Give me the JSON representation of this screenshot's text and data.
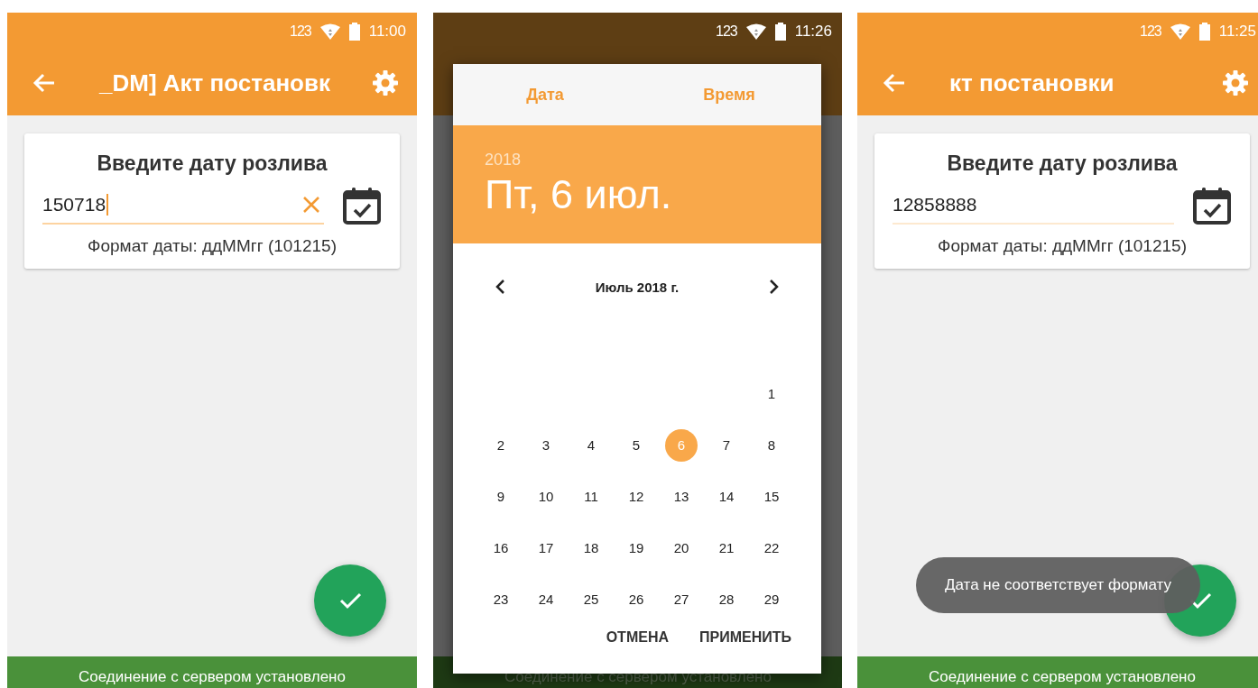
{
  "screens": [
    {
      "kind": "form",
      "status": {
        "indicator": "123",
        "time": "11:00"
      },
      "toolbar": {
        "title": "_DM] Акт постановк"
      },
      "card": {
        "title": "Введите дату розлива",
        "field": {
          "value": "150718",
          "focused": true,
          "clearable": true
        },
        "hint": "Формат даты: ддММгг (101215)"
      },
      "footer": "Соединение с сервером установлено"
    },
    {
      "kind": "picker",
      "status": {
        "indicator": "123",
        "time": "11:26"
      },
      "dialog": {
        "tabs": [
          "Дата",
          "Время"
        ],
        "year": "2018",
        "date": "Пт, 6 июл.",
        "month": "Июль 2018 г.",
        "weeks": [
          [
            {
              "day": "1",
              "selected": false
            }
          ],
          [
            {
              "day": "2",
              "selected": false
            },
            {
              "day": "3",
              "selected": false
            },
            {
              "day": "4",
              "selected": false
            },
            {
              "day": "5",
              "selected": false
            },
            {
              "day": "6",
              "selected": true
            },
            {
              "day": "7",
              "selected": false
            },
            {
              "day": "8",
              "selected": false
            }
          ],
          [
            {
              "day": "9",
              "selected": false
            },
            {
              "day": "10",
              "selected": false
            },
            {
              "day": "11",
              "selected": false
            },
            {
              "day": "12",
              "selected": false
            },
            {
              "day": "13",
              "selected": false
            },
            {
              "day": "14",
              "selected": false
            },
            {
              "day": "15",
              "selected": false
            }
          ],
          [
            {
              "day": "16",
              "selected": false
            },
            {
              "day": "17",
              "selected": false
            },
            {
              "day": "18",
              "selected": false
            },
            {
              "day": "19",
              "selected": false
            },
            {
              "day": "20",
              "selected": false
            },
            {
              "day": "21",
              "selected": false
            },
            {
              "day": "22",
              "selected": false
            }
          ],
          [
            {
              "day": "23",
              "selected": false
            },
            {
              "day": "24",
              "selected": false
            },
            {
              "day": "25",
              "selected": false
            },
            {
              "day": "26",
              "selected": false
            },
            {
              "day": "27",
              "selected": false
            },
            {
              "day": "28",
              "selected": false
            },
            {
              "day": "29",
              "selected": false
            }
          ]
        ],
        "buttons": [
          "ОТМЕНА",
          "ПРИМЕНИТЬ"
        ]
      },
      "footer": "Соединение с сервером установлено"
    },
    {
      "kind": "form",
      "status": {
        "indicator": "123",
        "time": "11:25"
      },
      "toolbar": {
        "title": "кт постановки"
      },
      "card": {
        "title": "Введите дату розлива",
        "field": {
          "value": "12858888",
          "focused": false,
          "clearable": false
        },
        "hint": "Формат даты: ддММгг (101215)"
      },
      "toast": "Дата не соответствует формату",
      "footer": "Соединение с сервером установлено"
    }
  ]
}
